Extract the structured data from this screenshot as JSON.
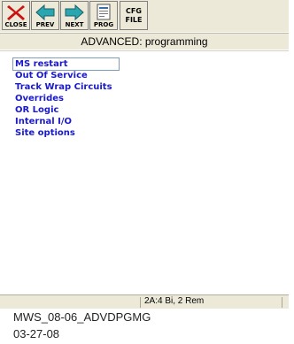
{
  "toolbar": {
    "buttons": [
      {
        "label": "CLOSE",
        "icon": "close-x-icon"
      },
      {
        "label": "PREV",
        "icon": "arrow-left-icon"
      },
      {
        "label": "NEXT",
        "icon": "arrow-right-icon"
      },
      {
        "label": "PROG",
        "icon": "program-document-icon"
      },
      {
        "label_line1": "CFG",
        "label_line2": "FILE"
      }
    ]
  },
  "header": {
    "title": "ADVANCED: programming"
  },
  "menu": {
    "items": [
      {
        "label": "MS restart",
        "selected": true
      },
      {
        "label": "Out Of Service",
        "selected": false
      },
      {
        "label": "Track Wrap Circuits",
        "selected": false
      },
      {
        "label": "Overrides",
        "selected": false
      },
      {
        "label": "OR Logic",
        "selected": false
      },
      {
        "label": "Internal I/O",
        "selected": false
      },
      {
        "label": "Site options",
        "selected": false
      }
    ]
  },
  "status": {
    "text": "2A:4 Bi, 2 Rem"
  },
  "caption": {
    "line1": "MWS_08-06_ADVDPGMG",
    "line2": "03-27-08"
  },
  "colors": {
    "menu_text": "#1a1acc",
    "chrome": "#ece9d8",
    "close_red": "#cc1111",
    "arrow_teal": "#2aa6b0"
  }
}
